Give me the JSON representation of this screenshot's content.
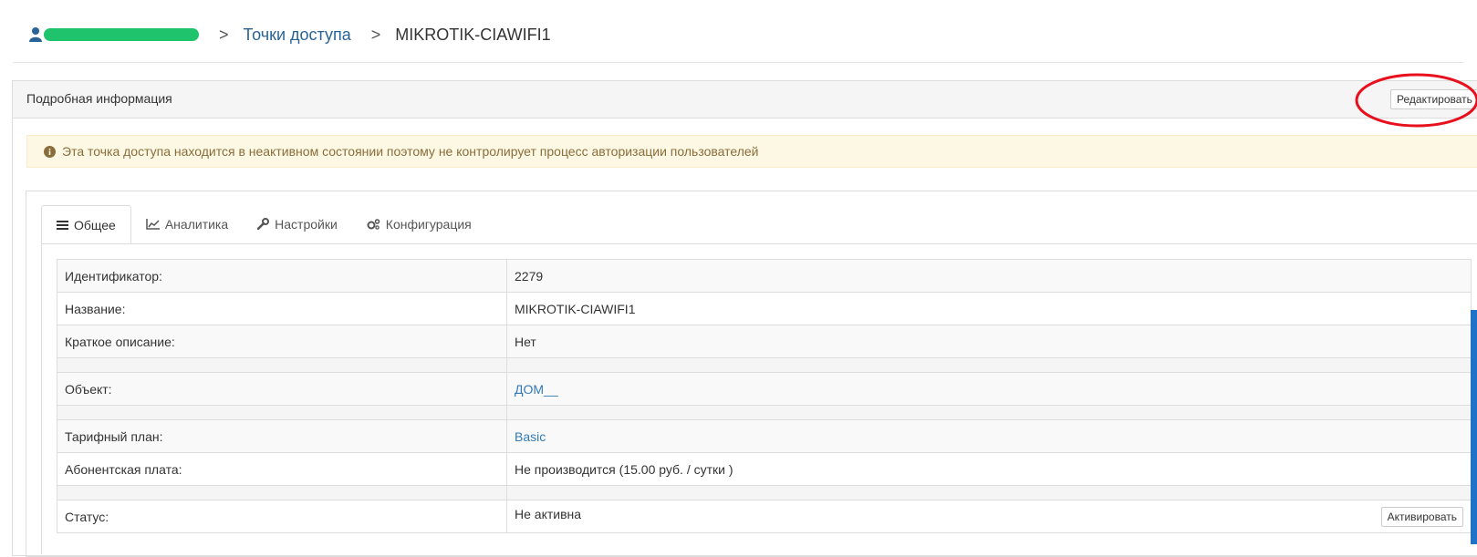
{
  "breadcrumb": {
    "sep1": ">",
    "access_points": "Точки доступа",
    "sep2": ">",
    "current": "MIKROTIK-CIAWIFI1"
  },
  "panel": {
    "title": "Подробная информация",
    "edit_label": "Редактировать"
  },
  "alert": {
    "icon": "info-circle-icon",
    "text": "Эта точка доступа находится в неактивном состоянии поэтому не контролирует процесс авторизации пользователей"
  },
  "tabs": [
    {
      "label": "Общее",
      "icon": "list-icon",
      "active": true
    },
    {
      "label": "Аналитика",
      "icon": "line-chart-icon",
      "active": false
    },
    {
      "label": "Настройки",
      "icon": "wrench-icon",
      "active": false
    },
    {
      "label": "Конфигурация",
      "icon": "cogs-icon",
      "active": false
    }
  ],
  "details": {
    "id_label": "Идентификатор:",
    "id_value": "2279",
    "name_label": "Название:",
    "name_value": "MIKROTIK-CIAWIFI1",
    "desc_label": "Краткое описание:",
    "desc_value": "Нет",
    "object_label": "Объект:",
    "object_value": "ДОМ__",
    "tariff_label": "Тарифный план:",
    "tariff_value": "Basic",
    "fee_label": "Абонентская плата:",
    "fee_value": "Не производится (15.00 руб. / сутки )",
    "status_label": "Статус:",
    "status_value": "Не активна",
    "activate_label": "Активировать"
  },
  "colors": {
    "link": "#337ab7",
    "alert_bg": "#fcf8e3",
    "alert_text": "#8a6d3b",
    "annotation": "#e8101c",
    "redaction": "#1fc36b"
  }
}
